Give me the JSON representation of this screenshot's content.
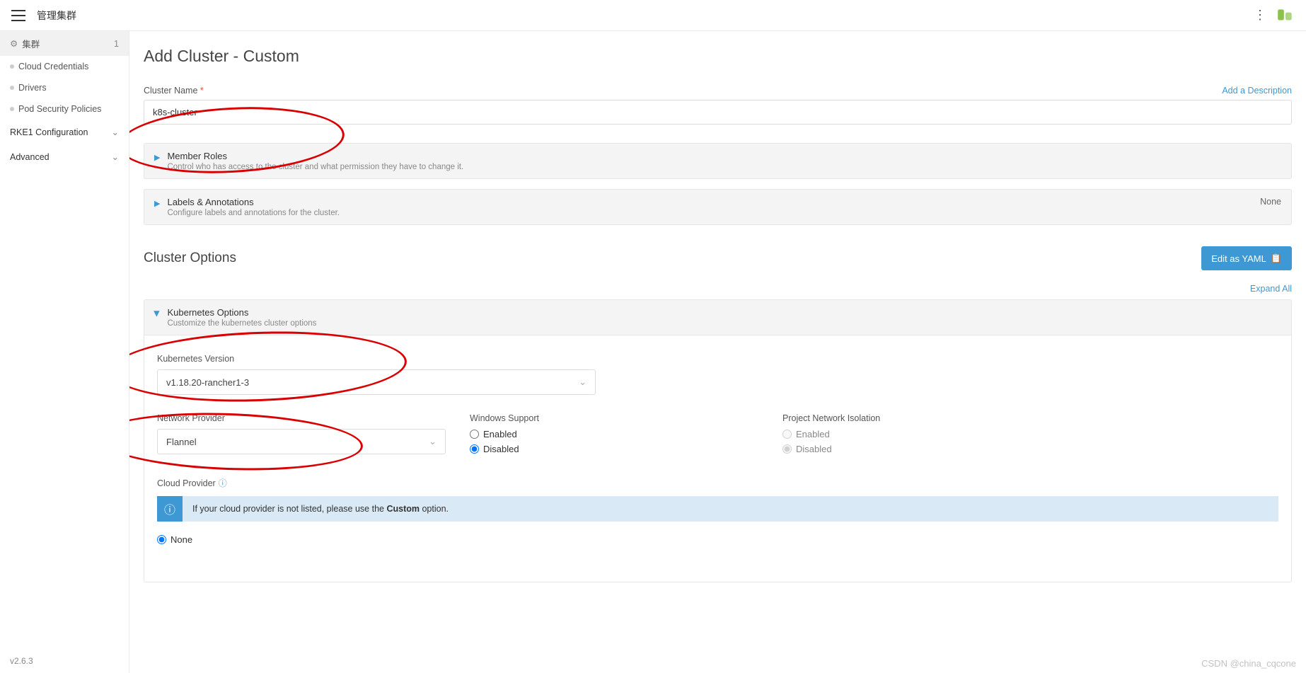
{
  "topbar": {
    "title": "管理集群"
  },
  "sidebar": {
    "clusters_label": "集群",
    "clusters_count": "1",
    "cloud_credentials": "Cloud Credentials",
    "drivers": "Drivers",
    "pod_security": "Pod Security Policies",
    "rke1_config": "RKE1 Configuration",
    "advanced": "Advanced",
    "version": "v2.6.3"
  },
  "page": {
    "title": "Add Cluster - Custom",
    "cluster_name_label": "Cluster Name",
    "cluster_name_value": "k8s-cluster",
    "add_description": "Add a Description"
  },
  "panels": {
    "member_title": "Member Roles",
    "member_sub": "Control who has access to the cluster and what permission they have to change it.",
    "labels_title": "Labels & Annotations",
    "labels_sub": "Configure labels and annotations for the cluster.",
    "labels_right": "None"
  },
  "options": {
    "title": "Cluster Options",
    "edit_yaml": "Edit as YAML",
    "expand_all": "Expand All",
    "k8s_title": "Kubernetes Options",
    "k8s_sub": "Customize the kubernetes cluster options",
    "k8s_version_label": "Kubernetes Version",
    "k8s_version_value": "v1.18.20-rancher1-3",
    "network_provider_label": "Network Provider",
    "network_provider_value": "Flannel",
    "windows_support_label": "Windows Support",
    "win_enabled": "Enabled",
    "win_disabled": "Disabled",
    "pni_label": "Project Network Isolation",
    "pni_enabled": "Enabled",
    "pni_disabled": "Disabled",
    "cloud_provider_label": "Cloud Provider",
    "cloud_info_pre": "If your cloud provider is not listed, please use the ",
    "cloud_info_bold": "Custom",
    "cloud_info_post": " option.",
    "none_label": "None"
  },
  "watermark": "CSDN @china_cqcone"
}
